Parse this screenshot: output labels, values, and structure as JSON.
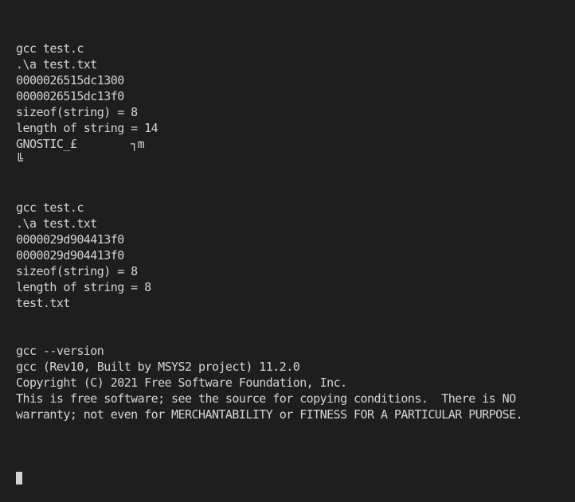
{
  "terminal": {
    "background_color": "#1e1e1e",
    "foreground_color": "#d4d4d4",
    "cursor_color": "#d4d4d4",
    "lines": [
      "gcc test.c",
      ".\\a test.txt",
      "0000026515dc1300",
      "0000026515dc13f0",
      "sizeof(string) = 8",
      "length of string = 14",
      "GNOSTIC_£        ┐m",
      "╚",
      "",
      "",
      "gcc test.c",
      ".\\a test.txt",
      "0000029d904413f0",
      "0000029d904413f0",
      "sizeof(string) = 8",
      "length of string = 8",
      "test.txt",
      "",
      "",
      "gcc --version",
      "gcc (Rev10, Built by MSYS2 project) 11.2.0",
      "Copyright (C) 2021 Free Software Foundation, Inc.",
      "This is free software; see the source for copying conditions.  There is NO",
      "warranty; not even for MERCHANTABILITY or FITNESS FOR A PARTICULAR PURPOSE.",
      ""
    ],
    "cursor_line_index": 25,
    "cursor_glyph": "block"
  }
}
